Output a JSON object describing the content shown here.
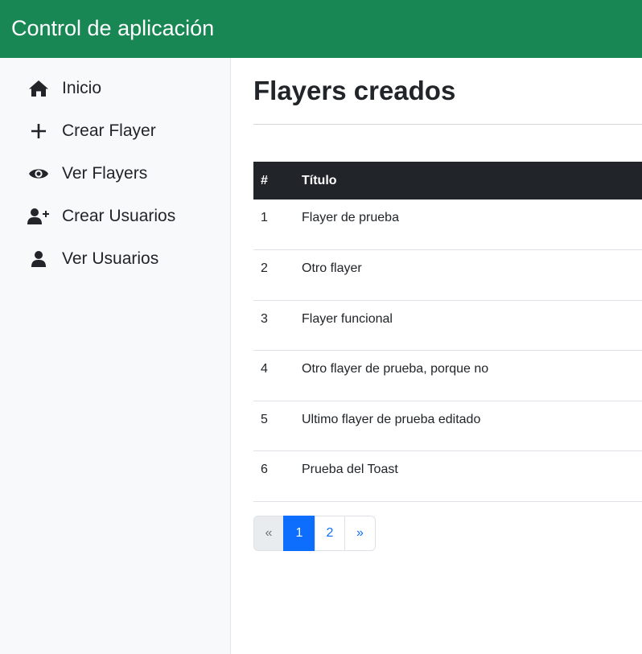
{
  "navbar": {
    "brand": "Control de aplicación"
  },
  "sidebar": {
    "items": [
      {
        "label": "Inicio",
        "icon": "home-icon"
      },
      {
        "label": "Crear Flayer",
        "icon": "plus-icon"
      },
      {
        "label": "Ver Flayers",
        "icon": "eye-icon"
      },
      {
        "label": "Crear Usuarios",
        "icon": "user-plus-icon"
      },
      {
        "label": "Ver Usuarios",
        "icon": "user-icon"
      }
    ]
  },
  "main": {
    "title": "Flayers creados",
    "table": {
      "headers": [
        "#",
        "Título"
      ],
      "rows": [
        {
          "id": "1",
          "title": "Flayer de prueba"
        },
        {
          "id": "2",
          "title": "Otro flayer"
        },
        {
          "id": "3",
          "title": "Flayer funcional"
        },
        {
          "id": "4",
          "title": "Otro flayer de prueba, porque no"
        },
        {
          "id": "5",
          "title": "Ultimo flayer de prueba editado"
        },
        {
          "id": "6",
          "title": "Prueba del Toast"
        }
      ]
    },
    "pagination": {
      "prev": "«",
      "pages": [
        "1",
        "2"
      ],
      "current_page": "1",
      "next": "»"
    }
  },
  "colors": {
    "navbar_bg": "#198754",
    "sidebar_bg": "#f8f9fa",
    "table_header_bg": "#212529",
    "pagination_active": "#0d6efd"
  }
}
